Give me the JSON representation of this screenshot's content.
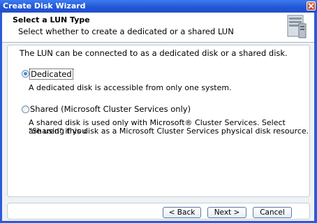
{
  "window": {
    "title": "Create Disk Wizard"
  },
  "header": {
    "title": "Select a LUN Type",
    "subtitle": "Select whether to create a dedicated or a shared LUN"
  },
  "content": {
    "intro": "The LUN can be connected to as a dedicated disk or a shared disk.",
    "options": [
      {
        "label": "Dedicated",
        "selected": true,
        "description": "A dedicated disk is accessible from only one system."
      },
      {
        "label": "Shared (Microsoft Cluster Services only)",
        "selected": false,
        "description_lines": [
          "A shared disk is used only with Microsoft® Cluster Services. Select \"Shared\" if you",
          "are using  this disk as a Microsoft Cluster Services physical disk resource."
        ]
      }
    ]
  },
  "footer": {
    "back_label": "< Back",
    "next_label": "Next >",
    "cancel_label": "Cancel"
  },
  "colors": {
    "titlebar": "#2357d6",
    "client_bg": "#eef2f5",
    "radio_dot": "#3a8ee0"
  }
}
